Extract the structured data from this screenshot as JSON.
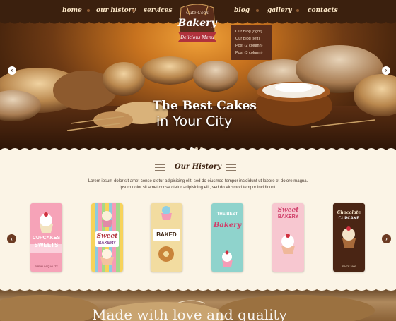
{
  "nav": {
    "items": [
      {
        "label": "home"
      },
      {
        "label": "our history"
      },
      {
        "label": "services"
      },
      {
        "label": "blog"
      },
      {
        "label": "gallery"
      },
      {
        "label": "contacts"
      }
    ],
    "blog_dropdown": [
      "Our Blog (right)",
      "Our Blog (left)",
      "Post (2 column)",
      "Post (3 column)"
    ]
  },
  "logo": {
    "script": "Cute Cook",
    "name": "Bakery",
    "tagline": "Delicious Menu"
  },
  "hero": {
    "title": "The Best Cakes",
    "subtitle": "in Your City",
    "prev": "‹",
    "next": "›",
    "slides": 3,
    "active_slide": 1
  },
  "history": {
    "title": "Our History",
    "text_line1": "Lorem ipsum dolor sit amet conse ctetur adipisicing elit, sed do eiusmod tempor incididunt ut labore et dolore magna.",
    "text_line2": "Ipsum dolor sit amet conse ctetur adipisicing elit, sed do eiusmod tempor incididunt.",
    "prev": "‹",
    "next": "›",
    "cards": [
      {
        "line1": "CUPCAKES",
        "line2": "SWEETS",
        "sub": "PREMIUM QUALITY"
      },
      {
        "line1": "Sweet",
        "line2": "BAKERY",
        "sub": ""
      },
      {
        "line1": "BAKED",
        "line2": "",
        "sub": ""
      },
      {
        "line1": "THE BEST",
        "line2": "Bakery",
        "sub": ""
      },
      {
        "line1": "Sweet",
        "line2": "BAKERY",
        "sub": ""
      },
      {
        "line1": "Chocolate",
        "line2": "CUPCAKE",
        "sub": "SINCE 1900"
      }
    ]
  },
  "bottom": {
    "partial_text": "Made with love and quality"
  },
  "colors": {
    "brand_dark": "#3b200e",
    "cream": "#fbf4e6",
    "accent": "#b0323c"
  }
}
